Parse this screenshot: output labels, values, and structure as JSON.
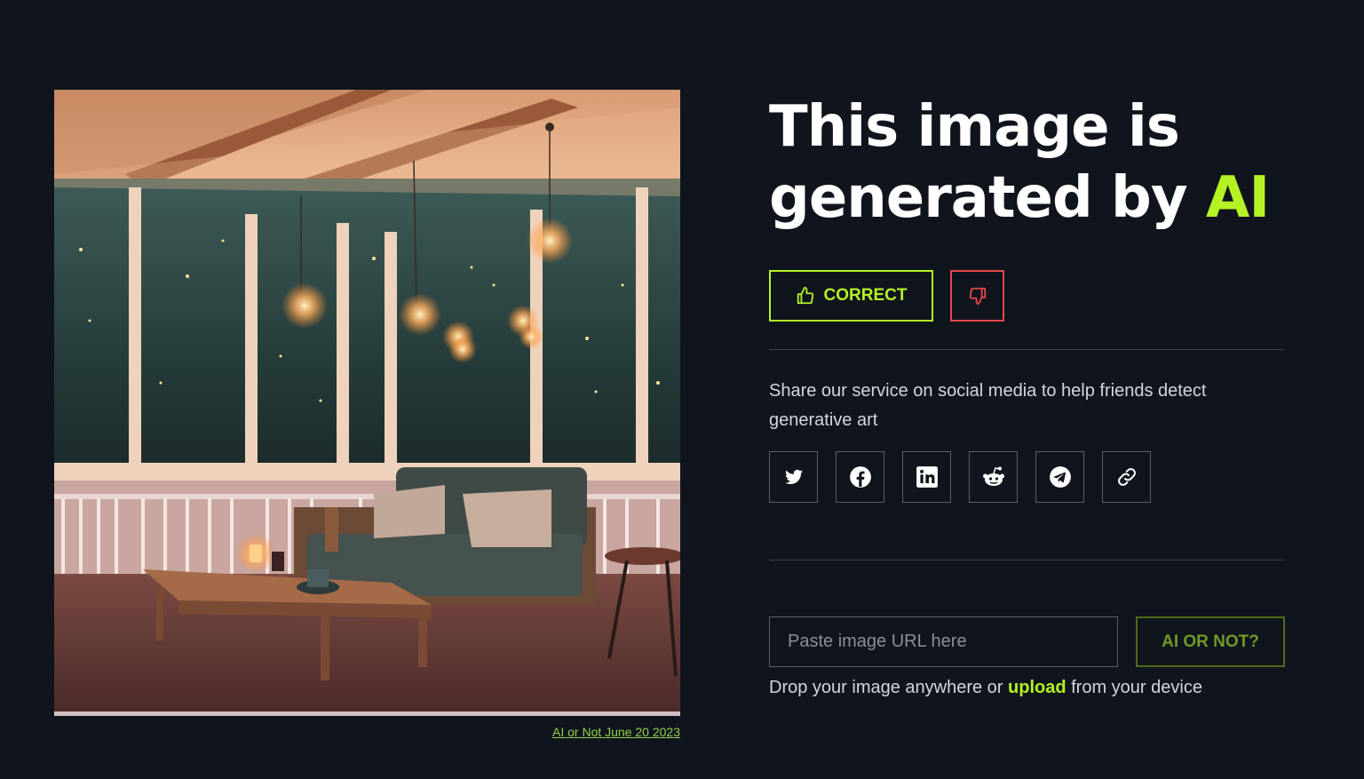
{
  "image": {
    "alt": "Screened porch at night with hanging bulb lights, a dark green sofa with cushions and a wooden coffee table"
  },
  "caption": {
    "link_text": "AI or Not June 20 2023"
  },
  "result": {
    "headline_prefix": "This image is generated by ",
    "headline_accent": "AI",
    "correct_label": "CORRECT"
  },
  "share": {
    "text": "Share our service on social media to help friends detect generative art",
    "icons": [
      "twitter-icon",
      "facebook-icon",
      "linkedin-icon",
      "reddit-icon",
      "telegram-icon",
      "link-icon"
    ]
  },
  "check": {
    "placeholder": "Paste image URL here",
    "button_label": "AI OR NOT?",
    "drop_prefix": "Drop your image anywhere or ",
    "upload_label": "upload",
    "drop_suffix": " from your device"
  },
  "colors": {
    "background": "#10141c",
    "accent": "#b4f224",
    "danger": "#e5484d"
  }
}
